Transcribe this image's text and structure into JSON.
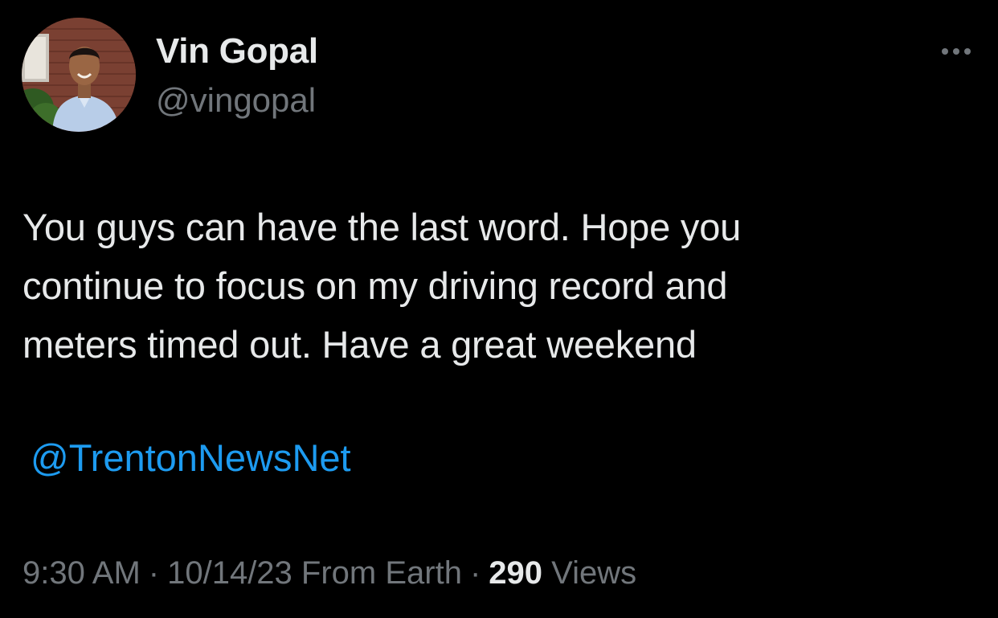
{
  "author": {
    "display_name": "Vin Gopal",
    "handle": "@vingopal",
    "avatar_icon": "profile-photo"
  },
  "more_icon": "more-horizontal-icon",
  "tweet": {
    "lines": [
      "You guys can have the last word. Hope you",
      "continue to focus on my driving record and",
      "meters timed out. Have a great weekend"
    ],
    "mention": "@TrentonNewsNet"
  },
  "meta": {
    "time": "9:30 AM",
    "separator": "·",
    "date": "10/14/23",
    "source": "From Earth",
    "views_count": "290",
    "views_label": "Views"
  },
  "colors": {
    "background": "#000000",
    "primary_text": "#e7e9ea",
    "secondary_text": "#71767b",
    "link": "#1d9bf0"
  }
}
